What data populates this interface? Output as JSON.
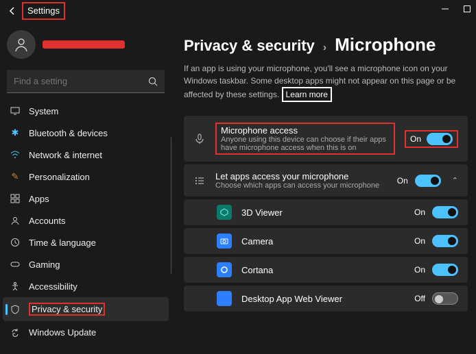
{
  "window": {
    "title": "Settings"
  },
  "search": {
    "placeholder": "Find a setting"
  },
  "sidebar": {
    "items": [
      {
        "label": "System"
      },
      {
        "label": "Bluetooth & devices"
      },
      {
        "label": "Network & internet"
      },
      {
        "label": "Personalization"
      },
      {
        "label": "Apps"
      },
      {
        "label": "Accounts"
      },
      {
        "label": "Time & language"
      },
      {
        "label": "Gaming"
      },
      {
        "label": "Accessibility"
      },
      {
        "label": "Privacy & security"
      },
      {
        "label": "Windows Update"
      }
    ]
  },
  "breadcrumb": {
    "root": "Privacy & security",
    "leaf": "Microphone"
  },
  "description": "If an app is using your microphone, you'll see a microphone icon on your Windows taskbar. Some desktop apps might not appear on this page or be affected by these settings.",
  "learn_more": "Learn more",
  "rows": {
    "mic_access": {
      "title": "Microphone access",
      "sub": "Anyone using this device can choose if their apps have microphone access when this is on",
      "state": "On"
    },
    "let_apps": {
      "title": "Let apps access your microphone",
      "sub": "Choose which apps can access your microphone",
      "state": "On"
    },
    "apps": [
      {
        "name": "3D Viewer",
        "state": "On",
        "color": "#0a7a6a"
      },
      {
        "name": "Camera",
        "state": "On",
        "color": "#2c7fff"
      },
      {
        "name": "Cortana",
        "state": "On",
        "color": "#2c7fff"
      },
      {
        "name": "Desktop App Web Viewer",
        "state": "Off",
        "color": "#2c7fff"
      }
    ]
  }
}
